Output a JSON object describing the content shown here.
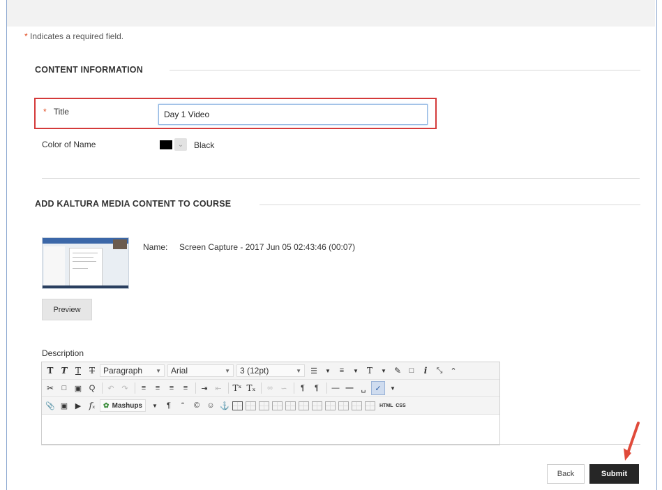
{
  "required_note": {
    "star": "*",
    "text": " Indicates a required field."
  },
  "content_info": {
    "heading": "CONTENT INFORMATION",
    "title_label": "Title",
    "title_star": "*",
    "title_value": "Day 1 Video",
    "color_label": "Color of Name",
    "color_value": "Black",
    "color_hex": "#000000"
  },
  "kaltura": {
    "heading": "ADD KALTURA MEDIA CONTENT TO COURSE",
    "name_label": "Name:",
    "name_value": "Screen Capture - 2017 Jun 05 02:43:46 (00:07)",
    "preview_label": "Preview"
  },
  "description": {
    "label": "Description",
    "format_select": "Paragraph",
    "font_select": "Arial",
    "size_select": "3 (12pt)",
    "mashups_label": "Mashups",
    "html_label": "HTML",
    "css_label": "CSS"
  },
  "footer": {
    "back_label": "Back",
    "submit_label": "Submit"
  },
  "colors": {
    "required_star": "#e04a1f",
    "highlight_border": "#d43a3a",
    "arrow": "#e04a3a",
    "submit_bg": "#262626"
  }
}
